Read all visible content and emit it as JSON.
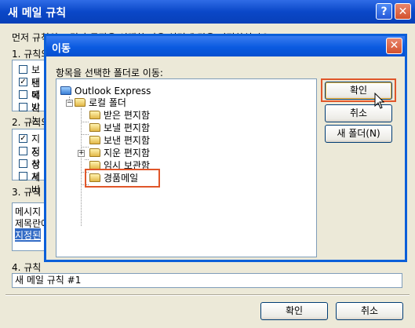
{
  "back_window": {
    "title": "새 메일 규칙",
    "help_btn": "?",
    "close_btn": "✕",
    "intro_label": "먼저 규칙의 조건과 동작을 선택한 다음 설명에 값을 지정하십시오.",
    "section1": "1. 규칙의",
    "cond_items": [
      "보낸",
      "제목",
      "메시",
      "받는"
    ],
    "section2": "2. 규칙의",
    "action_items": [
      "지정",
      "지정",
      "삭제",
      "서버"
    ],
    "section3": "3. 규칙",
    "desc_lines": [
      "메시지",
      "제목란에",
      "지정된"
    ],
    "section4": "4. 규칙",
    "rule_name": "새 메일 규칙 #1",
    "ok_label": "확인",
    "cancel_label": "취소"
  },
  "dialog": {
    "title": "이동",
    "close_btn": "✕",
    "prompt": "항목을 선택한 폴더로 이동:",
    "tree": {
      "root": "Outlook Express",
      "local": "로컬 폴더",
      "children": [
        "받은 편지함",
        "보낼 편지함",
        "보낸 편지함",
        "지운 편지함",
        "임시 보관함",
        "경품메일"
      ]
    },
    "ok_label": "확인",
    "cancel_label": "취소",
    "new_folder_label": "새 폴더(N)"
  }
}
